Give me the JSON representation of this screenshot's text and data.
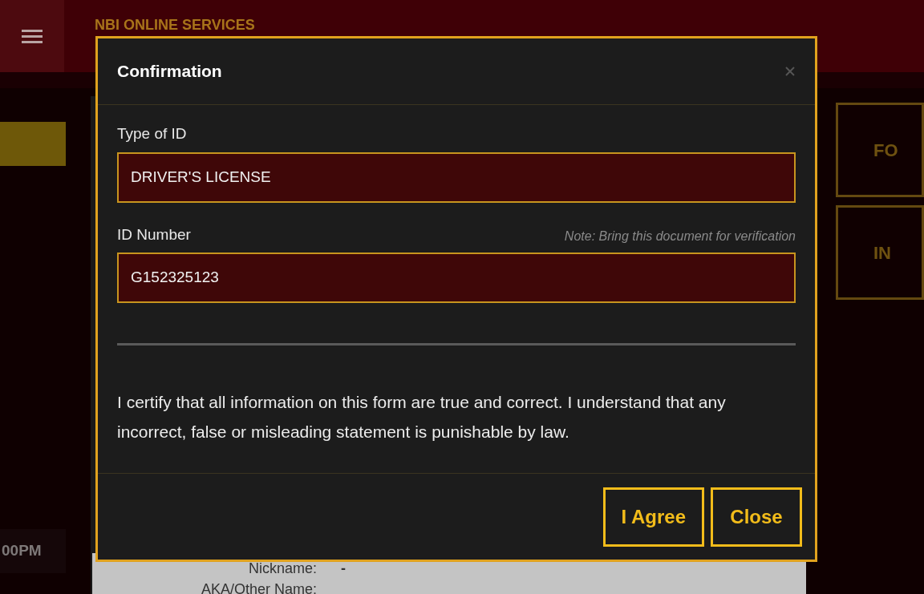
{
  "header": {
    "title": "NBI ONLINE SERVICES"
  },
  "left_panel": {
    "time_badge": "00PM"
  },
  "right_panel": {
    "cards": [
      "FO",
      "IN"
    ]
  },
  "background_form": {
    "rows": [
      {
        "label": "Nickname:",
        "value": "-"
      },
      {
        "label": "AKA/Other Name:",
        "value": ""
      }
    ]
  },
  "dialog": {
    "title": "Confirmation",
    "fields": [
      {
        "label": "Type of ID",
        "value": "DRIVER'S LICENSE"
      },
      {
        "label": "ID Number",
        "note": "Note: Bring this document for verification",
        "value": "G152325123"
      }
    ],
    "statement": "I certify that all information on this form are true and correct. I understand that any incorrect, false or misleading statement is punishable by law.",
    "buttons": [
      "I Agree",
      "Close"
    ]
  }
}
